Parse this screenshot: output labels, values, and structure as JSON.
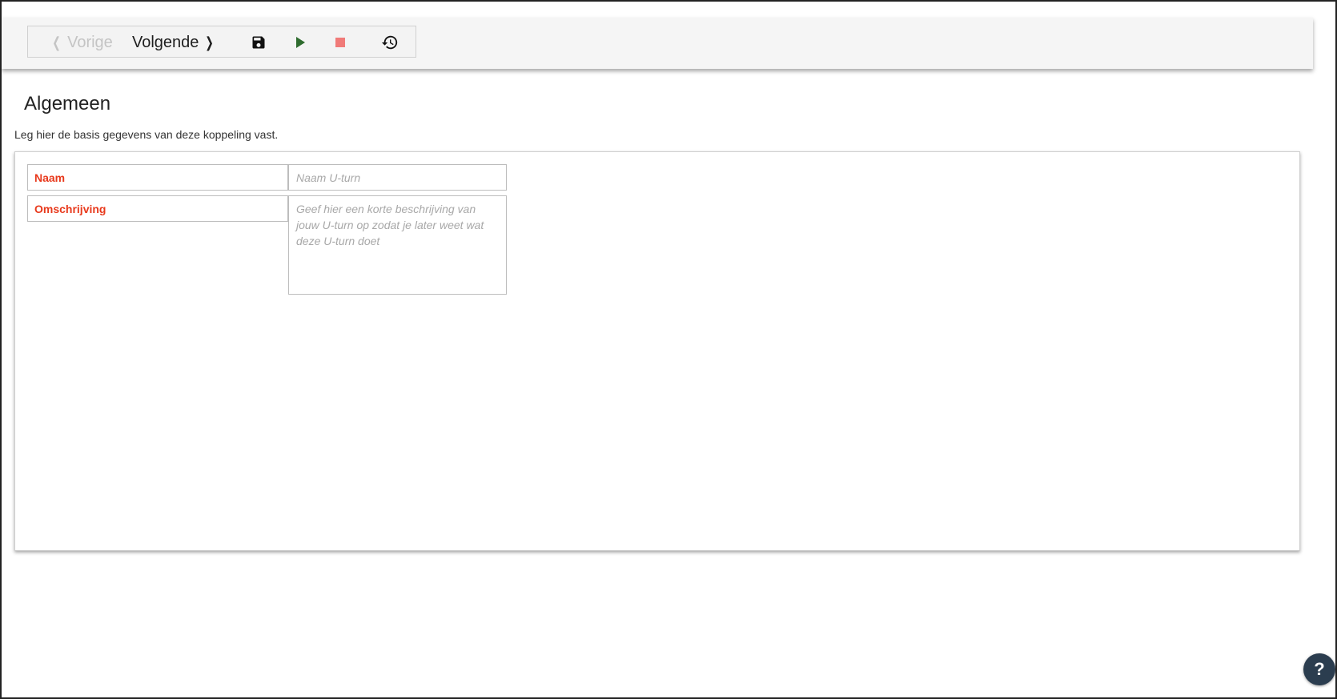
{
  "toolbar": {
    "prev_label": "Vorige",
    "next_label": "Volgende",
    "save_icon": "floppy-disk-icon",
    "play_icon": "play-icon",
    "stop_icon": "stop-icon",
    "history_icon": "history-icon",
    "colors": {
      "play": "#2e6b2e",
      "stop": "#f07a78",
      "disabled": "#c4c4c4"
    }
  },
  "section": {
    "title": "Algemeen",
    "description": "Leg hier de basis gegevens van deze koppeling vast."
  },
  "form": {
    "naam_label": "Naam",
    "naam_placeholder": "Naam U-turn",
    "omschrijving_label": "Omschrijving",
    "omschrijving_placeholder": "Geef hier een korte beschrijving van jouw U-turn op zodat je later weet wat deze U-turn doet",
    "label_color": "#e8391c"
  },
  "help": {
    "label": "?"
  }
}
